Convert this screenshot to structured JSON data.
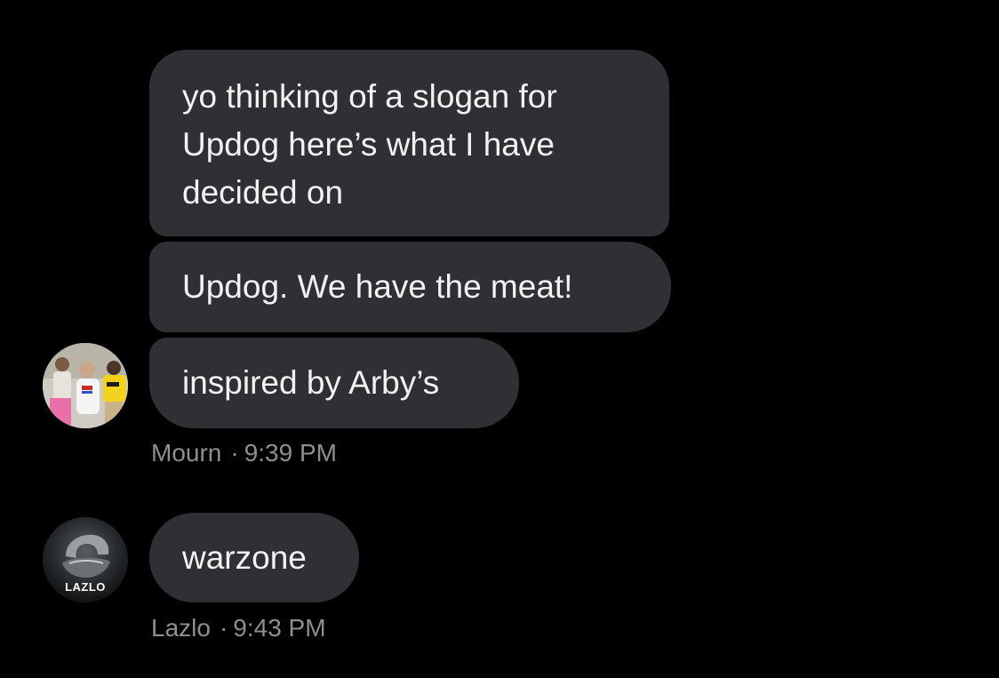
{
  "messages": [
    {
      "text_lines": [
        "yo thinking of a slogan for",
        "Updog here’s what I have",
        "decided on"
      ]
    },
    {
      "text": "Updog. We have the meat!"
    },
    {
      "text": "inspired by Arby’s"
    },
    {
      "text": "warzone"
    }
  ],
  "meta": [
    {
      "sender": "Mourn",
      "separator": "·",
      "time": "9:39 PM"
    },
    {
      "sender": "Lazlo",
      "separator": "·",
      "time": "9:43 PM"
    }
  ],
  "avatars": {
    "mourn": {
      "kind": "group-photo"
    },
    "lazlo": {
      "label": "LAZLO"
    }
  },
  "colors": {
    "background": "#000000",
    "bubble": "#2e3033",
    "text": "#f2f2f2",
    "meta": "#8e8e93"
  }
}
